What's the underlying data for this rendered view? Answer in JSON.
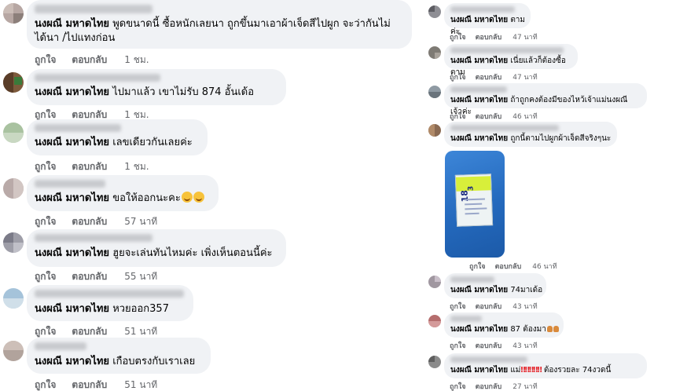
{
  "actions": {
    "like": "ถูกใจ",
    "reply": "ตอบกลับ"
  },
  "left_comments": [
    {
      "author": "นงผณี มหาดไทย",
      "text": "พูดขนาดนี้ ซื้อหนักเลยนา ถูกขึ้นมาเอาผ้าเจ็ดสีไปผูก จะว่ากันไม่",
      "text2": "ได้นา /ไปแทงก่อน",
      "time": "1 ชม."
    },
    {
      "author": "นงผณี มหาดไทย",
      "text": "ไปมาแล้ว เขาไม่รับ 874 อั้นเด้อ",
      "time": "1 ชม."
    },
    {
      "author": "นงผณี มหาดไทย",
      "text": "เลขเดียวกันเลยค่ะ",
      "time": "1 ชม."
    },
    {
      "author": "นงผณี มหาดไทย",
      "text": "ขอให้ออกนะคะ",
      "time": "57 นาที"
    },
    {
      "author": "นงผณี มหาดไทย",
      "text": "ฮูยจะเล่นทันไหมค่ะ เพิ่งเห็นตอนนี้ค่ะ",
      "time": "55 นาที"
    },
    {
      "author": "นงผณี มหาดไทย",
      "text": "หวยออก357",
      "time": "51 นาที"
    },
    {
      "author": "นงผณี มหาดไทย",
      "text": "เกือบตรงกับเราเลย",
      "time": "51 นาที"
    }
  ],
  "right_comments": [
    {
      "author": "นงผณี มหาดไทย",
      "text": "ตามค่ะ",
      "time": "47 นาที"
    },
    {
      "author": "นงผณี มหาดไทย",
      "text": "เนี่ยแล้วก็ต้องซื้อตาม",
      "time": "47 นาที"
    },
    {
      "author": "นงผณี มหาดไทย",
      "text": "ถ้าถูกคงต้องมีของไหว้เจ้าแม่นงผณีเจ้าค่ะ",
      "time": "46 นาที"
    },
    {
      "author": "นงผณี มหาดไทย",
      "text": "ถูกนี้ตามไปผูกผ้าเจ็ดสีจริงๆนะ",
      "time": ""
    },
    {
      "time": "46 นาที"
    },
    {
      "author": "นงผณี มหาดไทย",
      "text": "74มาเด้อ",
      "time": "43 นาที"
    },
    {
      "author": "นงผณี มหาดไทย",
      "text": "87 ต้องมา",
      "time": "43 นาที"
    },
    {
      "author": "นงผณี มหาดไทย",
      "text": "แม่",
      "text2": "ต้องรวยละ 74งวดนี้",
      "time": "27 นาที"
    }
  ],
  "photo": {
    "ticket_number": "18",
    "digit": "3"
  },
  "emoji": [
    "grinning-face-icon",
    "grinning-face-icon"
  ],
  "colors": {
    "bubble": "#f0f2f5",
    "action_text": "#65676b",
    "ticket_band": "#d8ef3a",
    "photo_bg": "#2469bd",
    "exclaim": "#e4262c"
  }
}
